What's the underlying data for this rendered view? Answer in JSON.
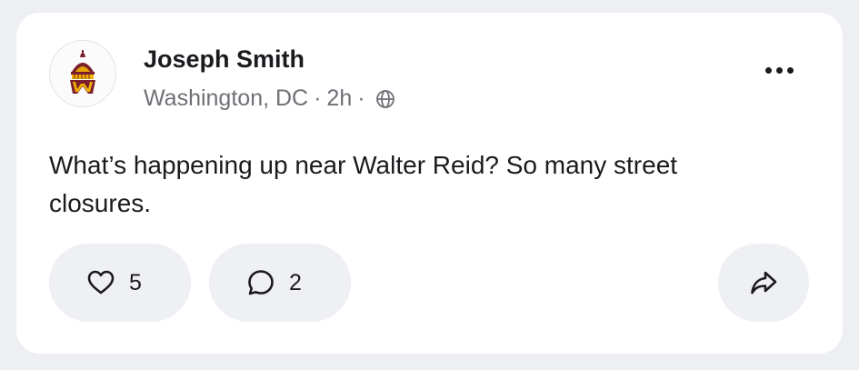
{
  "post": {
    "author": {
      "name": "Joseph Smith",
      "avatar_icon": "capitol-dome-w-logo-icon",
      "location": "Washington, DC",
      "separator": "·",
      "time": "2h",
      "visibility_icon": "globe-icon"
    },
    "more_icon": "more-horizontal-icon",
    "text": "What’s happening up near Walter Reid? So many street closures.",
    "actions": {
      "like": {
        "icon": "heart-outline-icon",
        "count": "5"
      },
      "comment": {
        "icon": "chat-bubble-icon",
        "count": "2"
      },
      "share": {
        "icon": "share-arrow-icon"
      }
    }
  },
  "colors": {
    "background": "#eeff2",
    "card": "#ffffff",
    "pill": "#eff0f3",
    "text_primary": "#1b1b1f",
    "text_secondary": "#6f7076",
    "logo_maroon": "#7a1f2b",
    "logo_gold": "#f2b300"
  }
}
